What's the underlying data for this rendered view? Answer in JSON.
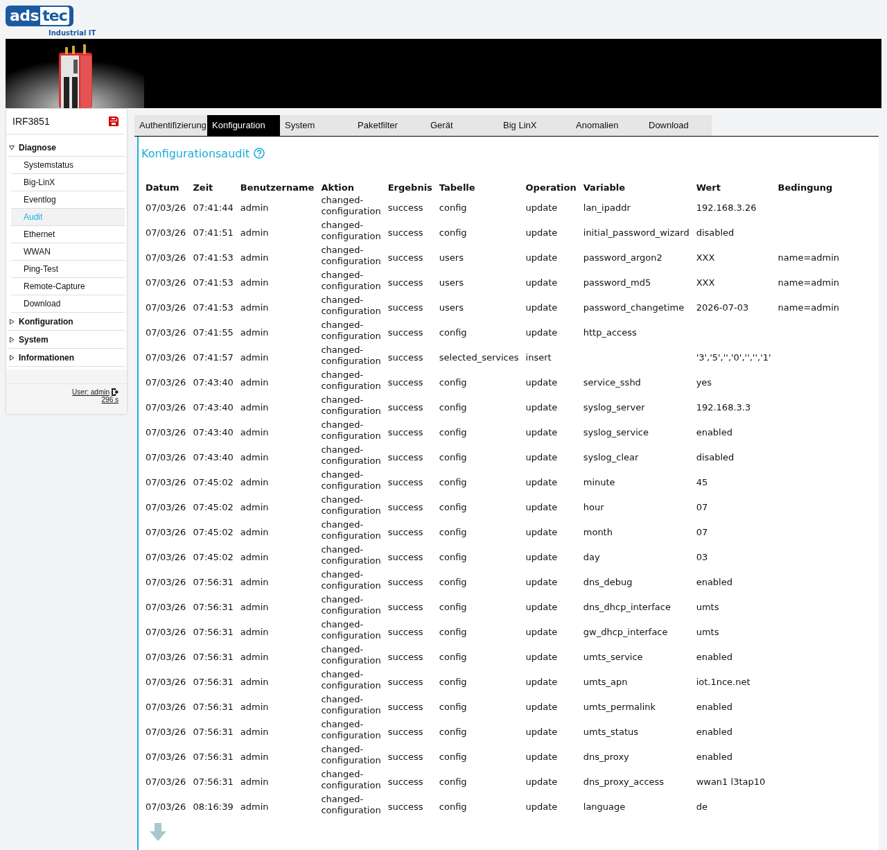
{
  "logo": {
    "part1": "ads",
    "part2": "tec",
    "tagline": "Industrial IT"
  },
  "sidebar": {
    "device": "IRF3851",
    "sections": [
      {
        "label": "Diagnose",
        "expanded": true,
        "children": [
          {
            "label": "Systemstatus",
            "selected": false
          },
          {
            "label": "Big-LinX",
            "selected": false
          },
          {
            "label": "Eventlog",
            "selected": false
          },
          {
            "label": "Audit",
            "selected": true
          },
          {
            "label": "Ethernet",
            "selected": false
          },
          {
            "label": "WWAN",
            "selected": false
          },
          {
            "label": "Ping-Test",
            "selected": false
          },
          {
            "label": "Remote-Capture",
            "selected": false
          },
          {
            "label": "Download",
            "selected": false
          }
        ]
      },
      {
        "label": "Konfiguration",
        "expanded": false
      },
      {
        "label": "System",
        "expanded": false
      },
      {
        "label": "Informationen",
        "expanded": false
      }
    ],
    "user": "User: admin",
    "timer": "296 s"
  },
  "tabs": [
    {
      "label": "Authentifizierung",
      "selected": false
    },
    {
      "label": "Konfiguration",
      "selected": true
    },
    {
      "label": "System",
      "selected": false
    },
    {
      "label": "Paketfilter",
      "selected": false
    },
    {
      "label": "Gerät",
      "selected": false
    },
    {
      "label": "Big LinX",
      "selected": false
    },
    {
      "label": "Anomalien",
      "selected": false
    },
    {
      "label": "Download",
      "selected": false
    }
  ],
  "heading": "Konfigurationsaudit",
  "table": {
    "columns": [
      "Datum",
      "Zeit",
      "Benutzername",
      "Aktion",
      "Ergebnis",
      "Tabelle",
      "Operation",
      "Variable",
      "Wert",
      "Bedingung"
    ],
    "rows": [
      [
        "07/03/26",
        "07:41:44",
        "admin",
        "changed-configuration",
        "success",
        "config",
        "update",
        "lan_ipaddr",
        "192.168.3.26",
        null
      ],
      [
        "07/03/26",
        "07:41:51",
        "admin",
        "changed-configuration",
        "success",
        "config",
        "update",
        "initial_password_wizard",
        "disabled",
        null
      ],
      [
        "07/03/26",
        "07:41:53",
        "admin",
        "changed-configuration",
        "success",
        "users",
        "update",
        "password_argon2",
        "XXX",
        "name=admin"
      ],
      [
        "07/03/26",
        "07:41:53",
        "admin",
        "changed-configuration",
        "success",
        "users",
        "update",
        "password_md5",
        "XXX",
        "name=admin"
      ],
      [
        "07/03/26",
        "07:41:53",
        "admin",
        "changed-configuration",
        "success",
        "users",
        "update",
        "password_changetime",
        "2026-07-03",
        "name=admin"
      ],
      [
        "07/03/26",
        "07:41:55",
        "admin",
        "changed-configuration",
        "success",
        "config",
        "update",
        "http_access",
        null,
        null
      ],
      [
        "07/03/26",
        "07:41:57",
        "admin",
        "changed-configuration",
        "success",
        "selected_services",
        "insert",
        null,
        "'3','5','','0','','','1'",
        null
      ],
      [
        "07/03/26",
        "07:43:40",
        "admin",
        "changed-configuration",
        "success",
        "config",
        "update",
        "service_sshd",
        "yes",
        null
      ],
      [
        "07/03/26",
        "07:43:40",
        "admin",
        "changed-configuration",
        "success",
        "config",
        "update",
        "syslog_server",
        "192.168.3.3",
        null
      ],
      [
        "07/03/26",
        "07:43:40",
        "admin",
        "changed-configuration",
        "success",
        "config",
        "update",
        "syslog_service",
        "enabled",
        null
      ],
      [
        "07/03/26",
        "07:43:40",
        "admin",
        "changed-configuration",
        "success",
        "config",
        "update",
        "syslog_clear",
        "disabled",
        null
      ],
      [
        "07/03/26",
        "07:45:02",
        "admin",
        "changed-configuration",
        "success",
        "config",
        "update",
        "minute",
        "45",
        null
      ],
      [
        "07/03/26",
        "07:45:02",
        "admin",
        "changed-configuration",
        "success",
        "config",
        "update",
        "hour",
        "07",
        null
      ],
      [
        "07/03/26",
        "07:45:02",
        "admin",
        "changed-configuration",
        "success",
        "config",
        "update",
        "month",
        "07",
        null
      ],
      [
        "07/03/26",
        "07:45:02",
        "admin",
        "changed-configuration",
        "success",
        "config",
        "update",
        "day",
        "03",
        null
      ],
      [
        "07/03/26",
        "07:56:31",
        "admin",
        "changed-configuration",
        "success",
        "config",
        "update",
        "dns_debug",
        "enabled",
        null
      ],
      [
        "07/03/26",
        "07:56:31",
        "admin",
        "changed-configuration",
        "success",
        "config",
        "update",
        "dns_dhcp_interface",
        "umts",
        null
      ],
      [
        "07/03/26",
        "07:56:31",
        "admin",
        "changed-configuration",
        "success",
        "config",
        "update",
        "gw_dhcp_interface",
        "umts",
        null
      ],
      [
        "07/03/26",
        "07:56:31",
        "admin",
        "changed-configuration",
        "success",
        "config",
        "update",
        "umts_service",
        "enabled",
        null
      ],
      [
        "07/03/26",
        "07:56:31",
        "admin",
        "changed-configuration",
        "success",
        "config",
        "update",
        "umts_apn",
        "iot.1nce.net",
        null
      ],
      [
        "07/03/26",
        "07:56:31",
        "admin",
        "changed-configuration",
        "success",
        "config",
        "update",
        "umts_permalink",
        "enabled",
        null
      ],
      [
        "07/03/26",
        "07:56:31",
        "admin",
        "changed-configuration",
        "success",
        "config",
        "update",
        "umts_status",
        "enabled",
        null
      ],
      [
        "07/03/26",
        "07:56:31",
        "admin",
        "changed-configuration",
        "success",
        "config",
        "update",
        "dns_proxy",
        "enabled",
        null
      ],
      [
        "07/03/26",
        "07:56:31",
        "admin",
        "changed-configuration",
        "success",
        "config",
        "update",
        "dns_proxy_access",
        "wwan1 l3tap10",
        null
      ],
      [
        "07/03/26",
        "08:16:39",
        "admin",
        "changed-configuration",
        "success",
        "config",
        "update",
        "language",
        "de",
        null
      ]
    ]
  }
}
